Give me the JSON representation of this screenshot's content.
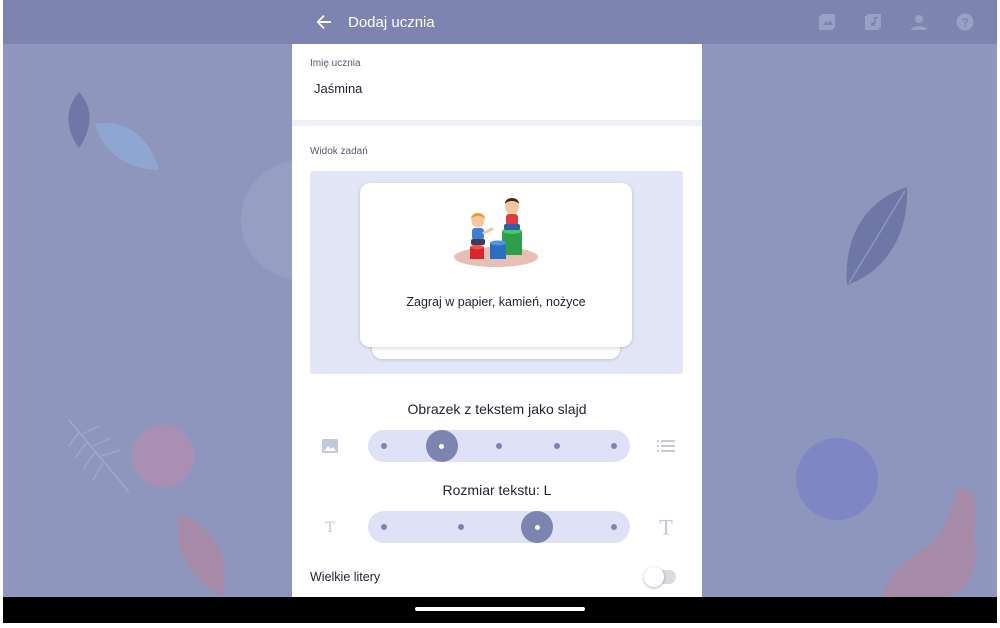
{
  "header": {
    "title": "Dodaj ucznia",
    "back_icon": "arrow-back-icon",
    "actions": [
      {
        "icon": "gallery-icon"
      },
      {
        "icon": "music-library-icon"
      },
      {
        "icon": "person-icon"
      },
      {
        "icon": "help-icon"
      }
    ]
  },
  "student": {
    "name_label": "Imię ucznia",
    "name_value": "Jaśmina"
  },
  "task_view": {
    "label": "Widok zadań",
    "card_text": "Zagraj w papier, kamień, nożyce",
    "card_image": "children-playing-illustration"
  },
  "display_mode": {
    "title": "Obrazek z tekstem jako slajd",
    "left_icon": "image-icon",
    "right_icon": "list-icon",
    "steps": 5,
    "selected_index": 1
  },
  "text_size": {
    "title": "Rozmiar tekstu: L",
    "left_icon": "text-small-icon",
    "right_icon": "text-large-icon",
    "steps": 4,
    "selected_index": 2
  },
  "uppercase": {
    "label": "Wielkie litery",
    "enabled": false
  },
  "colors": {
    "accent": "#7d84b0",
    "track": "#dfe2f6",
    "preview_bg": "#e3e6f7"
  }
}
